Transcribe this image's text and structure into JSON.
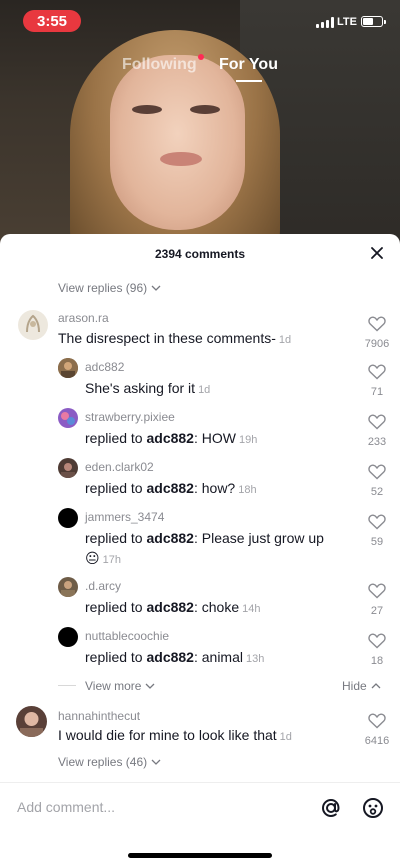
{
  "status_bar": {
    "time": "3:55",
    "network": "LTE",
    "battery_level": 0.55
  },
  "top_tabs": {
    "following": "Following",
    "for_you": "For You"
  },
  "comments_panel": {
    "title": "2394 comments",
    "view_replies_top": "View replies (96)",
    "comments": [
      {
        "username": "arason.ra",
        "text": "The disrespect in these comments-",
        "time": "1d",
        "likes": "7906",
        "avatar_color": "#d6d0c4"
      },
      {
        "username": "adc882",
        "text": "She's asking for it",
        "time": "1d",
        "likes": "71",
        "avatar_color": "#7b6246"
      },
      {
        "username": "strawberry.pixiee",
        "reply_prefix": "replied to ",
        "reply_to": "adc882",
        "text": ": HOW",
        "time": "19h",
        "likes": "233",
        "avatar_color": "#8b5cc4"
      },
      {
        "username": "eden.clark02",
        "reply_prefix": "replied to ",
        "reply_to": "adc882",
        "text": ": how?",
        "time": "18h",
        "likes": "52",
        "avatar_color": "#6b5148"
      },
      {
        "username": "jammers_3474",
        "reply_prefix": "replied to ",
        "reply_to": "adc882",
        "text": ": Please just grow up",
        "emoji": "😐",
        "time": "17h",
        "likes": "59",
        "avatar_color": "#000000"
      },
      {
        "username": ".d.arcy",
        "reply_prefix": "replied to ",
        "reply_to": "adc882",
        "text": ": choke",
        "time": "14h",
        "likes": "27",
        "avatar_color": "#7d6a52"
      },
      {
        "username": "nuttablecoochie",
        "reply_prefix": "replied to ",
        "reply_to": "adc882",
        "text": ": animal",
        "time": "13h",
        "likes": "18",
        "avatar_color": "#000000"
      },
      {
        "username": "hannahinthecut",
        "text": "I would die for mine to look like that",
        "time": "1d",
        "likes": "6416",
        "avatar_color": "#8a6a5a"
      }
    ],
    "view_more": "View more",
    "hide": "Hide",
    "view_replies_bottom": "View replies (46)",
    "add_comment_placeholder": "Add comment..."
  },
  "icons": {
    "close": "close-icon",
    "like": "heart-outline-icon",
    "mention": "at-icon",
    "emoji": "emoji-icon",
    "chevron": "chevron-down-icon"
  }
}
